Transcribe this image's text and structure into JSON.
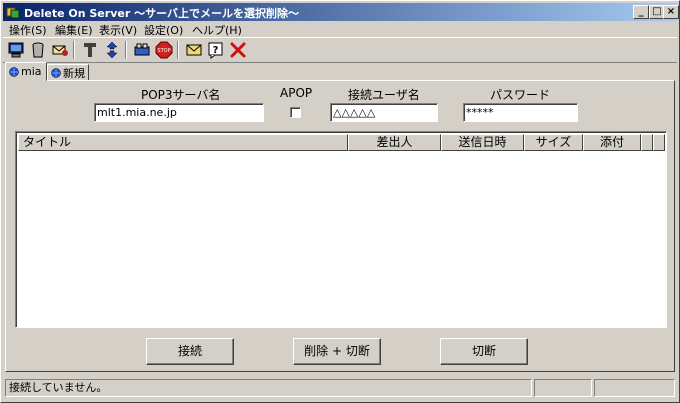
{
  "window": {
    "title": "Delete On Server  ～サーバ上でメールを選択削除～",
    "minimize_label": "_",
    "maximize_label": "□",
    "close_label": "×"
  },
  "menu": [
    "操作(S)",
    "編集(E)",
    "表示(V)",
    "設定(O)",
    "ヘルプ(H)"
  ],
  "toolbar": {
    "icons": [
      "monitor-icon",
      "trash-icon",
      "mail-hand-icon",
      "antenna-icon",
      "up-down-arrows-icon",
      "mailbox-icon",
      "stop-icon",
      "envelope-icon",
      "help-icon",
      "delete-x-icon"
    ],
    "stop_text": "STOP"
  },
  "tabs": [
    {
      "label": "mia",
      "active": true
    },
    {
      "label": "新規",
      "active": false
    }
  ],
  "account": {
    "pop3_label": "POP3サーバ名",
    "pop3_value": "mlt1.mia.ne.jp",
    "apop_label": "APOP",
    "apop_checked": false,
    "user_label": "接続ユーザ名",
    "user_value": "△△△△△",
    "password_label": "パスワード",
    "password_value": "*****"
  },
  "list": {
    "columns": [
      "タイトル",
      "差出人",
      "送信日時",
      "サイズ",
      "添付"
    ],
    "rows": []
  },
  "buttons": {
    "connect": "接続",
    "delete_disconnect": "削除 + 切断",
    "disconnect": "切断"
  },
  "status": {
    "text": "接続していません。",
    "panel2": "",
    "panel3": ""
  },
  "colors": {
    "face": "#d4d0c8",
    "title_start": "#0a246a",
    "title_end": "#a6caf0"
  }
}
